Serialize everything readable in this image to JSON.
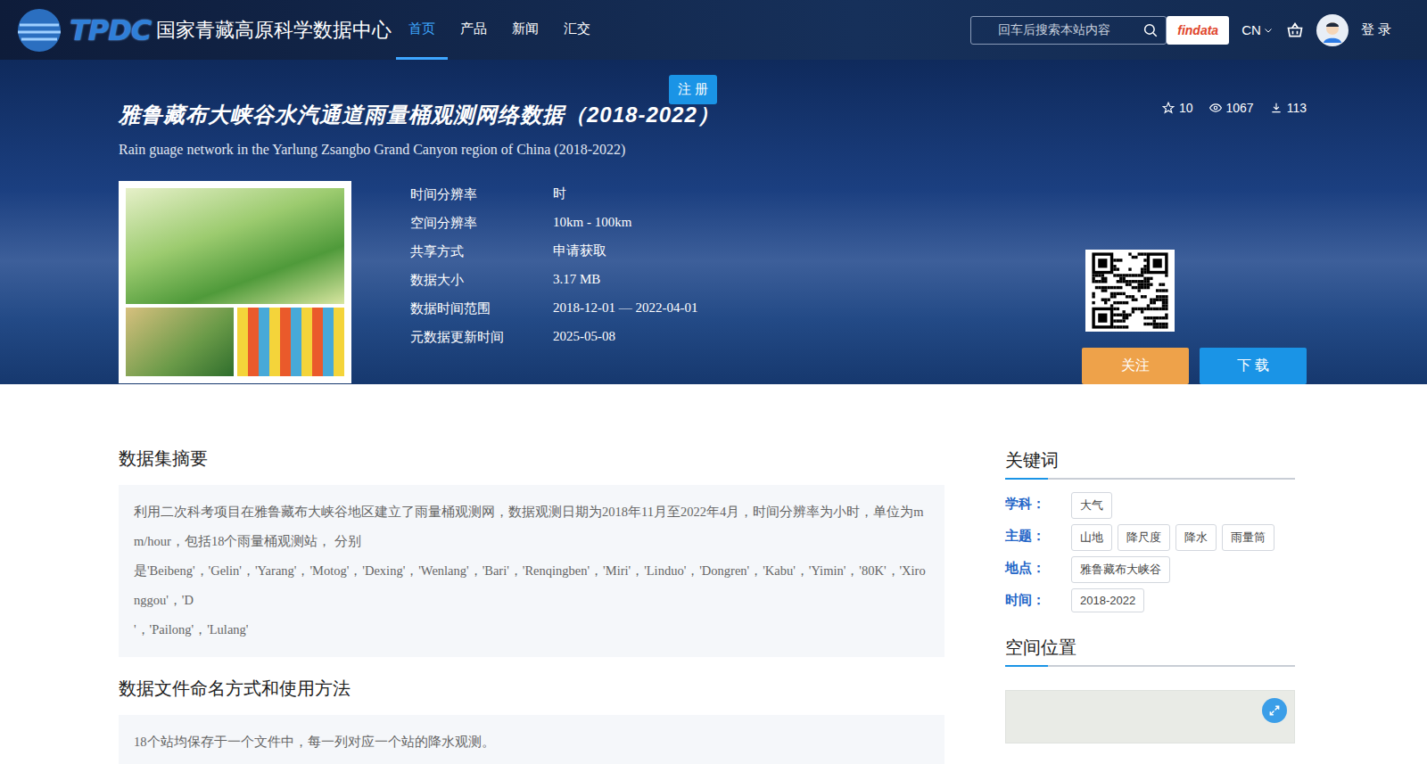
{
  "header": {
    "logo": {
      "mark": "TPDC",
      "name": "国家青藏高原科学数据中心"
    },
    "nav": [
      {
        "label": "首页",
        "selected": true
      },
      {
        "label": "产品",
        "selected": false
      },
      {
        "label": "新闻",
        "selected": false
      },
      {
        "label": "汇交",
        "selected": false
      }
    ],
    "search": {
      "placeholder": "回车后搜索本站内容"
    },
    "findata": "findata",
    "lang": "CN",
    "login": "登 录"
  },
  "register": "注 册",
  "dataset": {
    "title": "雅鲁藏布大峡谷水汽通道雨量桶观测网络数据（2018-2022）",
    "subtitle": "Rain guage network in the Yarlung Zsangbo Grand Canyon region of China (2018-2022)",
    "stats": [
      {
        "kind": "star",
        "value": "10"
      },
      {
        "kind": "eye",
        "value": "1067"
      },
      {
        "kind": "download",
        "value": "113"
      }
    ],
    "info": [
      {
        "label": "时间分辨率",
        "value": "时"
      },
      {
        "label": "空间分辨率",
        "value": "10km - 100km"
      },
      {
        "label": "共享方式",
        "value": "申请获取"
      },
      {
        "label": "数据大小",
        "value": "3.17 MB"
      },
      {
        "label": "数据时间范围",
        "value": "2018-12-01 — 2022-04-01"
      },
      {
        "label": "元数据更新时间",
        "value": "2025-05-08"
      }
    ],
    "follow": "关注",
    "download": "下 载"
  },
  "sections": [
    {
      "title": "数据集摘要",
      "paragraphs": [
        "利用二次科考项目在雅鲁藏布大峡谷地区建立了雨量桶观测网，数据观测日期为2018年11月至2022年4月，时间分辨率为小时，单位为mm/hour，包括18个雨量桶观测站， 分别",
        "是'Beibeng'，'Gelin'，'Yarang'，'Motog'，'Dexing'，'Wenlang'，'Bari'，'Renqingben'，'Miri'，'Linduo'，'Dongren'，'Kabu'，'Yimin'，'80K'，'Xironggou'，'D",
        "'，'Pailong'，'Lulang'"
      ]
    },
    {
      "title": "数据文件命名方式和使用方法",
      "paragraphs": [
        "18个站均保存于一个文件中，每一列对应一个站的降水观测。"
      ]
    }
  ],
  "keywords": {
    "title": "关键词",
    "groups": [
      {
        "label": "学科：",
        "tags": [
          "大气"
        ]
      },
      {
        "label": "主题：",
        "tags": [
          "山地",
          "降尺度",
          "降水",
          "雨量筒"
        ]
      },
      {
        "label": "地点：",
        "tags": [
          "雅鲁藏布大峡谷"
        ]
      },
      {
        "label": "时间：",
        "tags": [
          "2018-2022"
        ]
      }
    ]
  },
  "space": {
    "title": "空间位置"
  }
}
